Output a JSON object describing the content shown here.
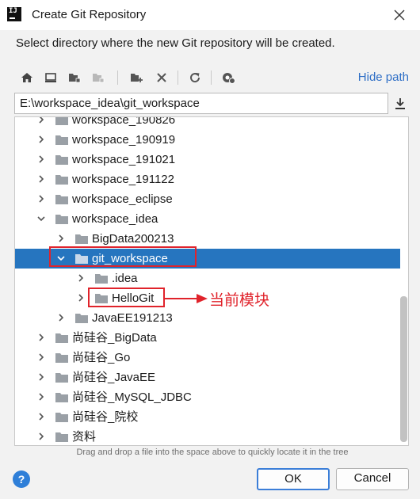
{
  "window": {
    "title": "Create Git Repository",
    "app_icon_text": "IJ"
  },
  "description": "Select directory where the new Git repository will be created.",
  "toolbar": {
    "buttons": [
      "home-icon",
      "desktop-icon",
      "project-folder-icon",
      "module-folder-icon",
      "new-folder-icon",
      "delete-icon",
      "refresh-icon",
      "show-hidden-icon"
    ],
    "hide_path_label": "Hide path"
  },
  "path": {
    "value": "E:\\workspace_idea\\git_workspace"
  },
  "tree": {
    "rows": [
      {
        "label": "workspace_190826",
        "level": 1,
        "expanded": false
      },
      {
        "label": "workspace_190919",
        "level": 1,
        "expanded": false
      },
      {
        "label": "workspace_191021",
        "level": 1,
        "expanded": false
      },
      {
        "label": "workspace_191122",
        "level": 1,
        "expanded": false
      },
      {
        "label": "workspace_eclipse",
        "level": 1,
        "expanded": false
      },
      {
        "label": "workspace_idea",
        "level": 1,
        "expanded": true
      },
      {
        "label": "BigData200213",
        "level": 2,
        "expanded": false
      },
      {
        "label": "git_workspace",
        "level": 2,
        "expanded": true,
        "selected": true
      },
      {
        "label": ".idea",
        "level": 3,
        "expanded": false
      },
      {
        "label": "HelloGit",
        "level": 3,
        "expanded": false
      },
      {
        "label": "JavaEE191213",
        "level": 2,
        "expanded": false
      },
      {
        "label": "尚硅谷_BigData",
        "level": 1,
        "expanded": false
      },
      {
        "label": "尚硅谷_Go",
        "level": 1,
        "expanded": false
      },
      {
        "label": "尚硅谷_JavaEE",
        "level": 1,
        "expanded": false
      },
      {
        "label": "尚硅谷_MySQL_JDBC",
        "level": 1,
        "expanded": false
      },
      {
        "label": "尚硅谷_院校",
        "level": 1,
        "expanded": false
      },
      {
        "label": "资料",
        "level": 1,
        "expanded": false
      }
    ]
  },
  "hint": "Drag and drop a file into the space above to quickly locate it in the tree",
  "buttons": {
    "help": "?",
    "ok": "OK",
    "cancel": "Cancel"
  },
  "annotation": {
    "text": "当前模块",
    "color": "#e0232b"
  },
  "colors": {
    "selection": "#2675bf",
    "link": "#2f6fc6",
    "folder": "#9aa0a6"
  }
}
